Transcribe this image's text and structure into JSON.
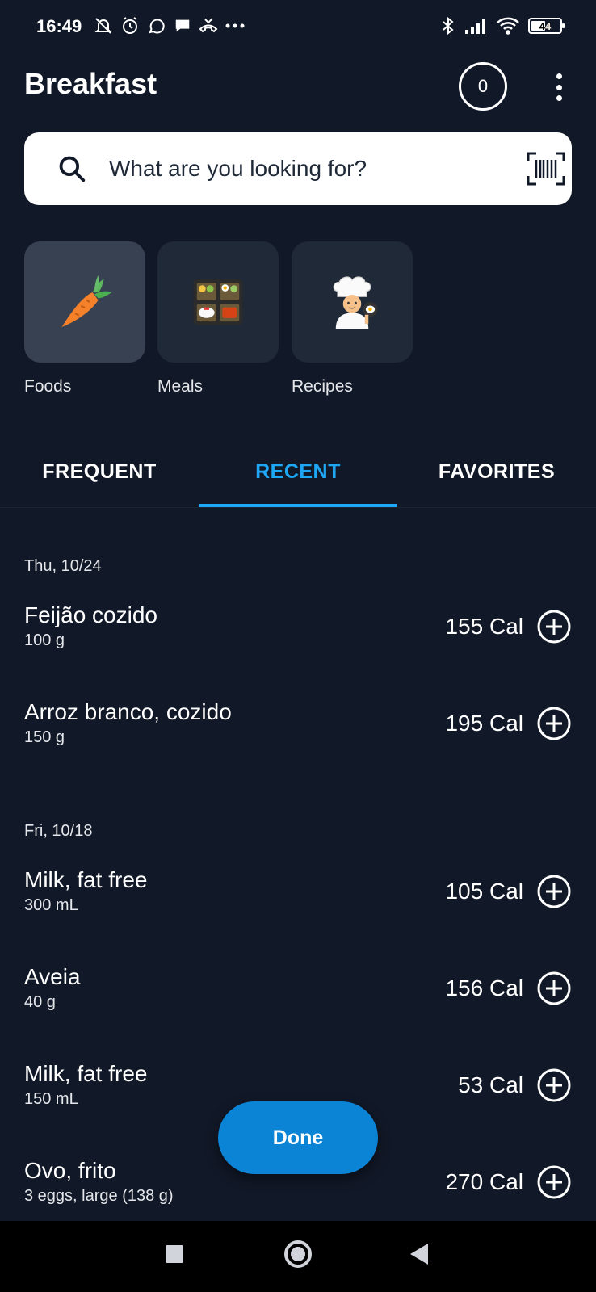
{
  "status_bar": {
    "time": "16:49",
    "battery": "44",
    "icons_left": [
      "mute-bell-icon",
      "alarm-icon",
      "whatsapp-icon",
      "chat-bubble-icon",
      "missed-call-icon",
      "more-dots-icon"
    ],
    "icons_right": [
      "bluetooth-icon",
      "signal-icon",
      "wifi-icon",
      "battery-icon"
    ]
  },
  "header": {
    "title": "Breakfast",
    "counter": "0"
  },
  "search": {
    "placeholder": "What are you looking for?"
  },
  "categories": [
    {
      "label": "Foods",
      "icon": "carrot-icon",
      "active": true
    },
    {
      "label": "Meals",
      "icon": "bento-box-icon",
      "active": false
    },
    {
      "label": "Recipes",
      "icon": "chef-icon",
      "active": false
    }
  ],
  "tabs": [
    {
      "label": "FREQUENT"
    },
    {
      "label": "RECENT"
    },
    {
      "label": "FAVORITES"
    }
  ],
  "active_tab": "RECENT",
  "groups": [
    {
      "date": "Thu, 10/24",
      "items": [
        {
          "name": "Feijão cozido",
          "portion": "100 g",
          "calories": "155 Cal"
        },
        {
          "name": "Arroz branco, cozido",
          "portion": "150 g",
          "calories": "195 Cal"
        }
      ]
    },
    {
      "date": "Fri, 10/18",
      "items": [
        {
          "name": "Milk, fat free",
          "portion": "300 mL",
          "calories": "105 Cal"
        },
        {
          "name": "Aveia",
          "portion": "40 g",
          "calories": "156 Cal"
        },
        {
          "name": "Milk, fat free",
          "portion": "150 mL",
          "calories": "53 Cal"
        },
        {
          "name": "Ovo, frito",
          "portion": "3 eggs, large (138 g)",
          "calories": "270 Cal"
        }
      ]
    }
  ],
  "done_button": "Done",
  "colors": {
    "background": "#111827",
    "accent": "#1ea7f5",
    "done_button": "#0b84d6",
    "tile": "#1f2937"
  }
}
